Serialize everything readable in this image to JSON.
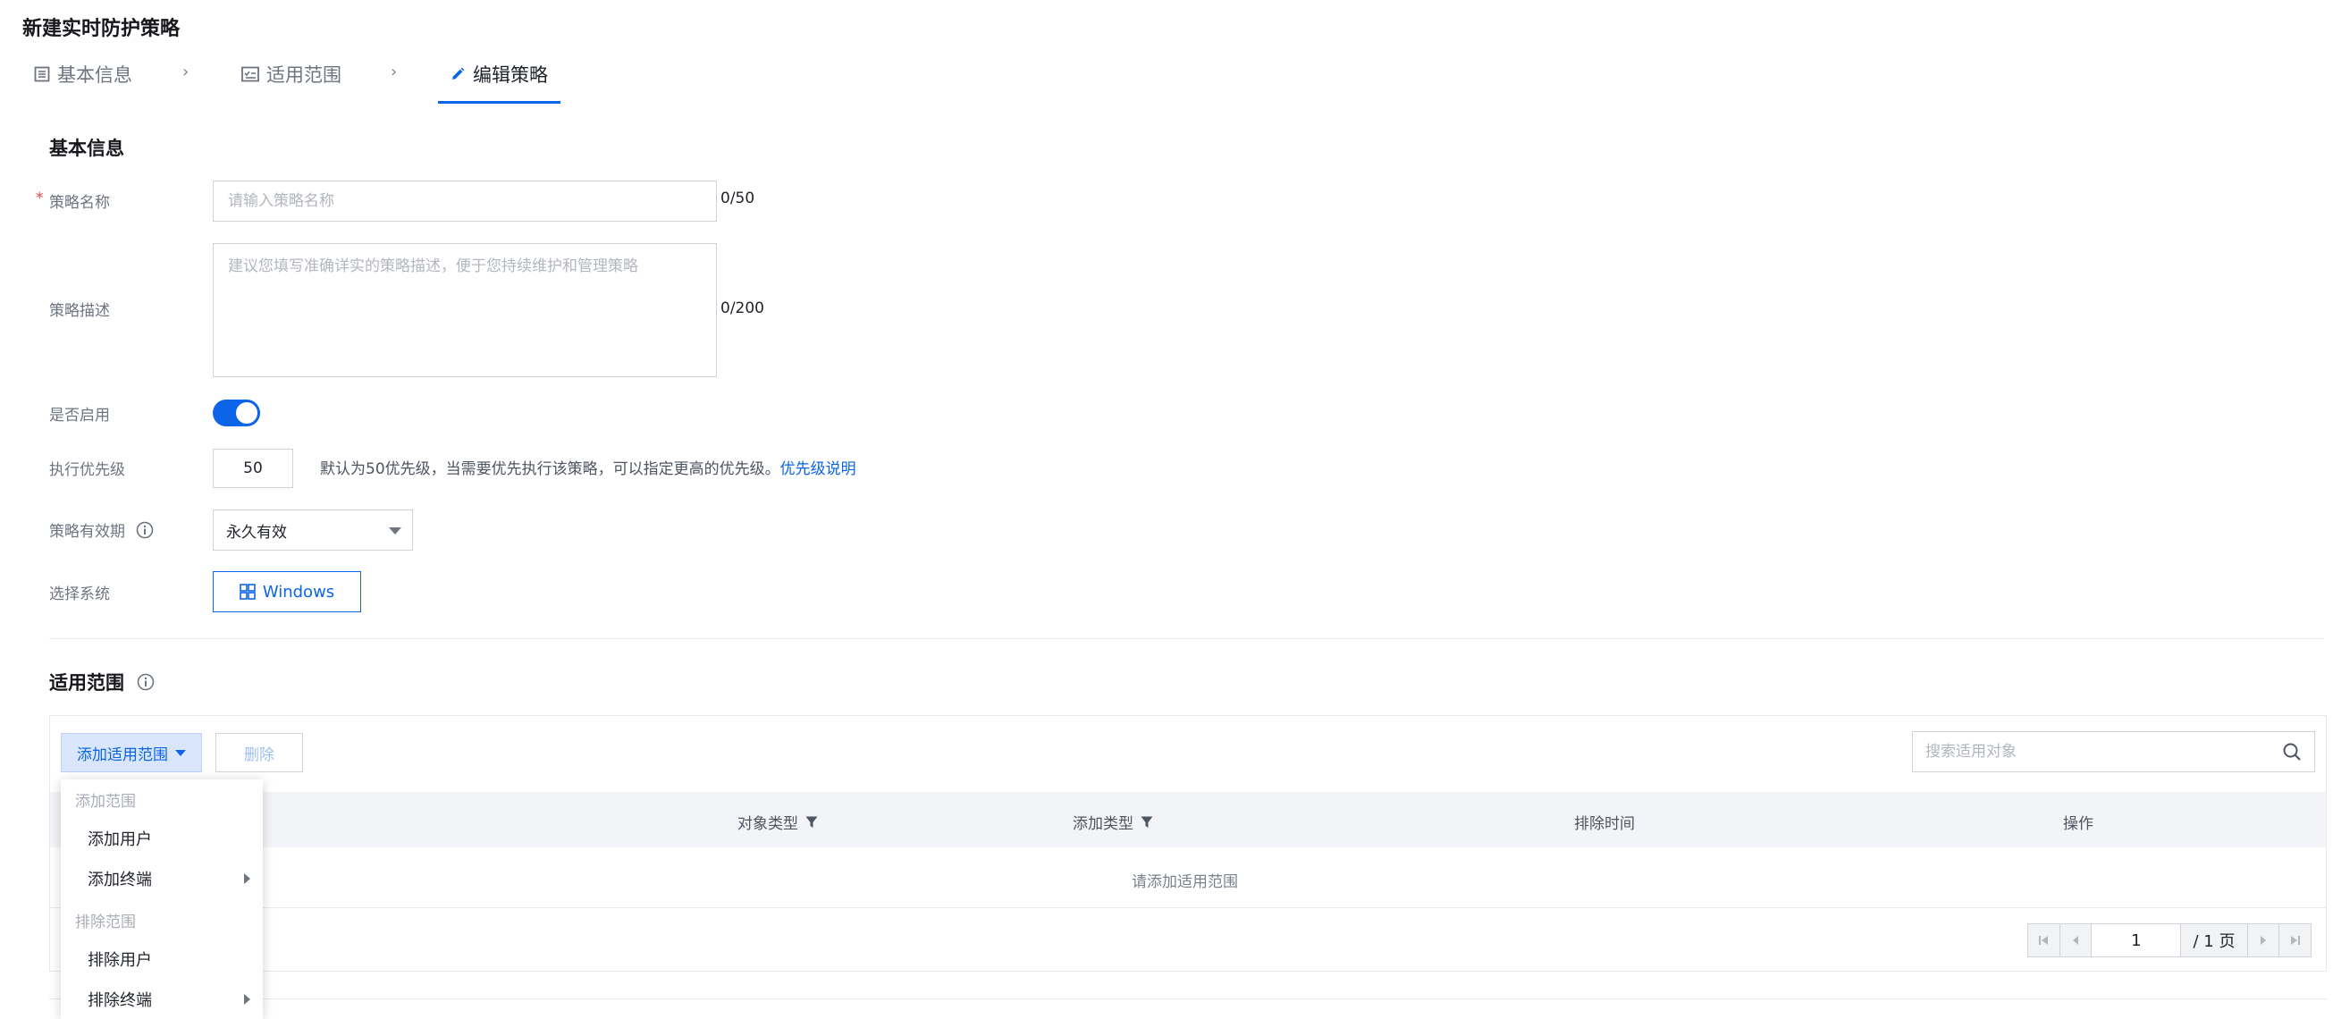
{
  "page": {
    "title": "新建实时防护策略"
  },
  "steps": [
    {
      "label": "基本信息",
      "icon": "list-icon",
      "active": false
    },
    {
      "label": "适用范围",
      "icon": "checklist-icon",
      "active": false
    },
    {
      "label": "编辑策略",
      "icon": "edit-icon",
      "active": true
    }
  ],
  "basic": {
    "section_title": "基本信息",
    "name": {
      "label": "策略名称",
      "required_mark": "*",
      "placeholder": "请输入策略名称",
      "value": "",
      "counter": "0/50"
    },
    "description": {
      "label": "策略描述",
      "placeholder": "建议您填写准确详实的策略描述，便于您持续维护和管理策略",
      "value": "",
      "counter": "0/200"
    },
    "enabled": {
      "label": "是否启用",
      "value": true
    },
    "priority": {
      "label": "执行优先级",
      "value": "50",
      "hint": "默认为50优先级，当需要优先执行该策略，可以指定更高的优先级。",
      "link": "优先级说明"
    },
    "validity": {
      "label": "策略有效期",
      "value": "永久有效"
    },
    "system": {
      "label": "选择系统",
      "button": "Windows"
    }
  },
  "scope": {
    "section_title": "适用范围",
    "add_button": "添加适用范围",
    "delete_button": "删除",
    "search_placeholder": "搜索适用对象",
    "columns": [
      "对象类型",
      "添加类型",
      "排除时间",
      "操作"
    ],
    "empty_text": "请添加适用范围",
    "pagination": {
      "current_page": "1",
      "total_text": "/ 1 页"
    },
    "menu": {
      "group_add": "添加范围",
      "add_user": "添加用户",
      "add_terminal": "添加终端",
      "group_exclude": "排除范围",
      "exclude_user": "排除用户",
      "exclude_terminal": "排除终端"
    }
  },
  "colors": {
    "accent": "#0c64e8",
    "required": "#e54545",
    "header_bg": "#f3f4f7"
  }
}
